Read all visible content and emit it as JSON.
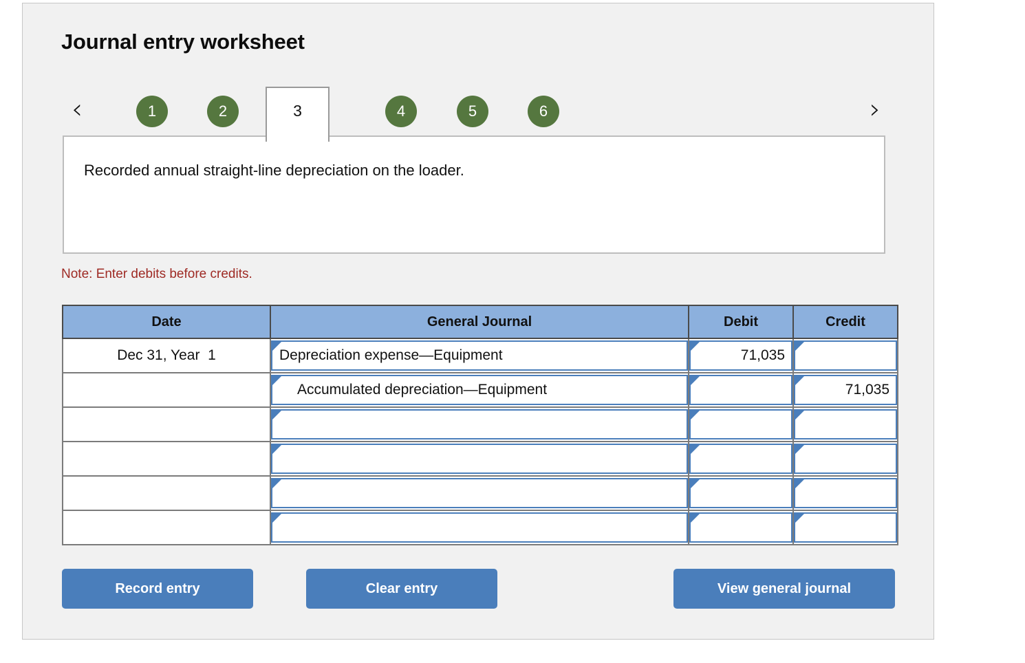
{
  "page": {
    "title": "Journal entry worksheet"
  },
  "nav": {
    "prev_icon": "chevron-left-icon",
    "next_icon": "chevron-right-icon",
    "prev_glyph": "‹",
    "next_glyph": "›",
    "tabs": [
      {
        "label": "1",
        "active": false
      },
      {
        "label": "2",
        "active": false
      },
      {
        "label": "3",
        "active": true
      },
      {
        "label": "4",
        "active": false
      },
      {
        "label": "5",
        "active": false
      },
      {
        "label": "6",
        "active": false
      }
    ],
    "active_tab": "3"
  },
  "description": {
    "text": "Recorded annual straight-line depreciation on the loader."
  },
  "note": {
    "text": "Note: Enter debits before credits."
  },
  "table": {
    "headers": {
      "date": "Date",
      "general_journal": "General Journal",
      "debit": "Debit",
      "credit": "Credit"
    },
    "rows": [
      {
        "date": "Dec 31, Year  1",
        "account": "Depreciation expense—Equipment",
        "indent": false,
        "debit": "71,035",
        "credit": ""
      },
      {
        "date": "",
        "account": "Accumulated depreciation—Equipment",
        "indent": true,
        "debit": "",
        "credit": "71,035"
      },
      {
        "date": "",
        "account": "",
        "indent": false,
        "debit": "",
        "credit": ""
      },
      {
        "date": "",
        "account": "",
        "indent": false,
        "debit": "",
        "credit": ""
      },
      {
        "date": "",
        "account": "",
        "indent": false,
        "debit": "",
        "credit": ""
      },
      {
        "date": "",
        "account": "",
        "indent": false,
        "debit": "",
        "credit": ""
      }
    ]
  },
  "buttons": {
    "record": "Record entry",
    "clear": "Clear entry",
    "view": "View general journal"
  },
  "colors": {
    "tab_green": "#55773f",
    "header_blue": "#8cb0dd",
    "button_blue": "#4a7ebb",
    "note_red": "#9e2a24",
    "card_bg": "#f1f1f1"
  }
}
